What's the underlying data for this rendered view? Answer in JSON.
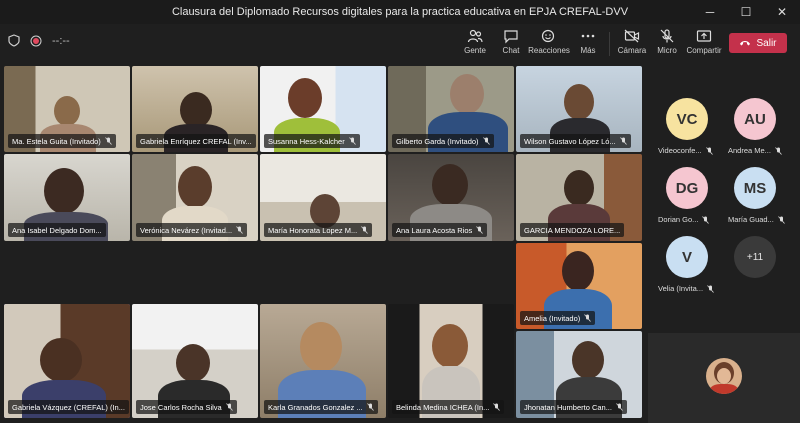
{
  "window": {
    "title": "Clausura del Diplomado Recursos digitales para la practica educativa en EPJA CREFAL-DVV",
    "minimize": "─",
    "maximize": "☐",
    "close": "✕"
  },
  "toolbar": {
    "timer": "--:--",
    "buttons": [
      {
        "label": "Gente"
      },
      {
        "label": "Chat"
      },
      {
        "label": "Reacciones"
      },
      {
        "label": "Más"
      },
      {
        "label": "Cámara"
      },
      {
        "label": "Micro"
      },
      {
        "label": "Compartir"
      }
    ],
    "leave_label": "Salir"
  },
  "participants": [
    {
      "name": "Ma. Estela Guita (Invitado)"
    },
    {
      "name": "Gabriela Enríquez CREFAL (Inv..."
    },
    {
      "name": "Susanna Hess-Kalcher"
    },
    {
      "name": "Gilberto Garda (Invitado)"
    },
    {
      "name": "Wilson Gustavo López Ló..."
    },
    {
      "name": "Ana Isabel Delgado Dom..."
    },
    {
      "name": "Verónica Nevárez (Invitad..."
    },
    {
      "name": "María Honorata Lopez M..."
    },
    {
      "name": "Ana Laura Acosta Rios"
    },
    {
      "name": "GARCIA MENDOZA LORE..."
    },
    {
      "name": "Amelia (Invitado)"
    },
    {
      "name": "Gabriela Vázquez (CREFAL) (In..."
    },
    {
      "name": "Jose Carlos Rocha Silva"
    },
    {
      "name": "Karla Granados Gonzalez ..."
    },
    {
      "name": "Belinda Medina ICHEA (In..."
    },
    {
      "name": "Jhonatan Humberto Can..."
    }
  ],
  "sidebar": {
    "avatars": [
      {
        "initials": "VC",
        "label": "Videoconfe...",
        "color": "#f7e3a0"
      },
      {
        "initials": "AU",
        "label": "Andrea Me...",
        "color": "#f5c6d0"
      },
      {
        "initials": "DG",
        "label": "Dorian Go...",
        "color": "#f5c6d0"
      },
      {
        "initials": "MS",
        "label": "María Guad...",
        "color": "#c9dff2"
      },
      {
        "initials": "V",
        "label": "Velia (Invita...",
        "color": "#c9dff2"
      }
    ],
    "more_count": "+11"
  }
}
